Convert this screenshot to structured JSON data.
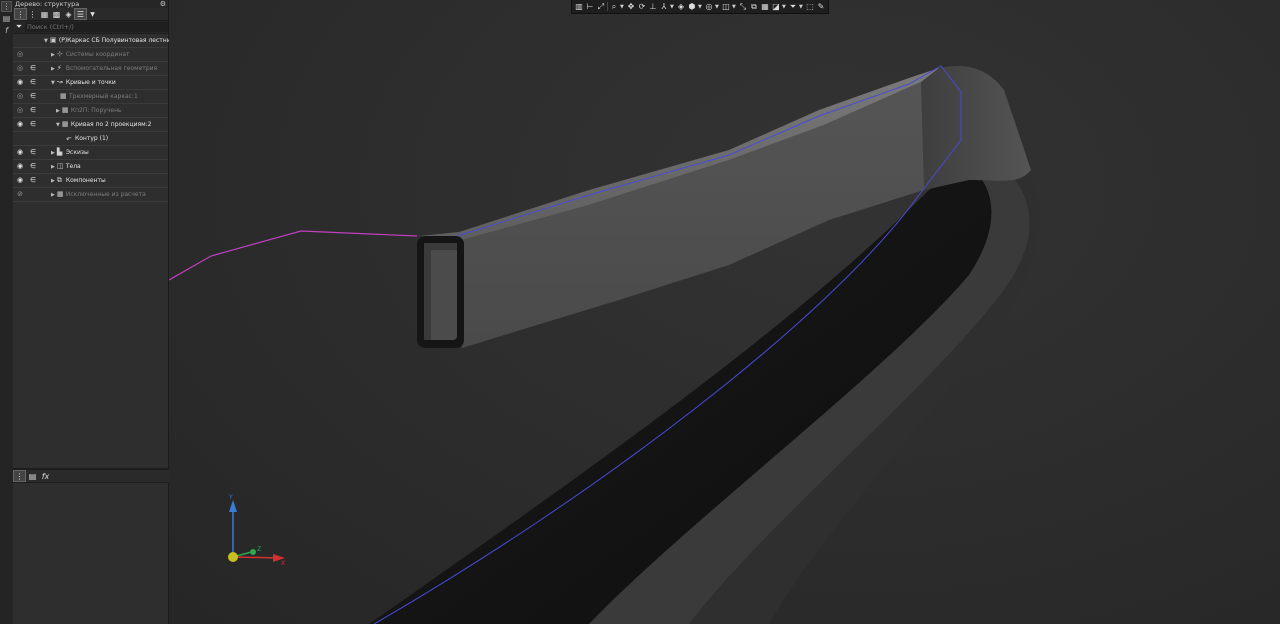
{
  "panel": {
    "title": "Дерево: структура",
    "search_placeholder": "Поиск (Ctrl+/)"
  },
  "tree": {
    "root": "(Р)Каркас СБ Полувинтовая лестница (",
    "items": [
      {
        "label": "Системы координат",
        "visible": "eye-hidden-icon",
        "style": "dim"
      },
      {
        "label": "Вспомогательная геометрия",
        "visible": "eye-hidden-icon",
        "style": "dim"
      },
      {
        "label": "Кривые и точки",
        "visible": "eye-icon",
        "style": "bright"
      },
      {
        "label": "Трехмерный каркас:1",
        "visible": "eye-hidden-icon",
        "style": "dim"
      },
      {
        "label": "Кп2П: Поручень",
        "visible": "eye-hidden-icon",
        "style": "dim"
      },
      {
        "label": "Кривая по 2 проекциям:2",
        "visible": "eye-icon",
        "style": "bright"
      },
      {
        "label": "Контур (1)",
        "visible": "eye-icon",
        "style": "bright"
      },
      {
        "label": "Эскизы",
        "visible": "eye-icon",
        "style": "bright"
      },
      {
        "label": "Тела",
        "visible": "eye-icon",
        "style": "bright"
      },
      {
        "label": "Компоненты",
        "visible": "eye-icon",
        "style": "bright"
      },
      {
        "label": "Исключенные из расчета",
        "visible": "eye-off-icon",
        "style": "dim"
      }
    ]
  },
  "viewport": {
    "triad_axes": [
      "Y",
      "Z",
      "X"
    ]
  },
  "colors": {
    "curve_magenta": "#c040c0",
    "curve_blue": "#4a4ad8",
    "axis_blue": "#3a7bd5",
    "axis_green": "#2fa84f",
    "axis_red": "#d03030",
    "origin_yellow": "#c8c020"
  }
}
